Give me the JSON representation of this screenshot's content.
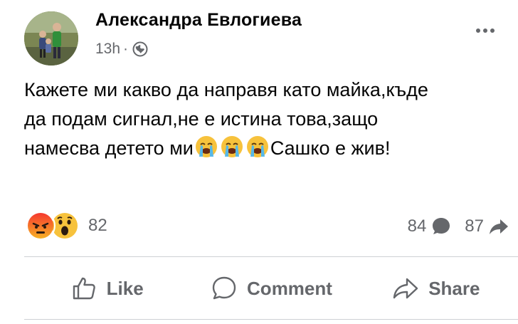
{
  "post": {
    "author": "Александра Евлогиева",
    "time": "13h",
    "separator": "·",
    "audience_icon": "globe-icon",
    "text_line1": "Кажете ми какво да направя като майка,къде",
    "text_line2": "да подам сигнал,не е истина това,защо",
    "text_line3_before": "намесва детето ми",
    "text_line3_after": "Сашко е жив!",
    "inline_emoji": "loudly-crying-face-emoji",
    "inline_emoji_count": 3
  },
  "reactions": {
    "icons": [
      "angry-reaction-icon",
      "wow-reaction-icon"
    ],
    "count": "82",
    "comments_count": "84",
    "shares_count": "87"
  },
  "actions": {
    "like_label": "Like",
    "comment_label": "Comment",
    "share_label": "Share"
  },
  "colors": {
    "secondary_text": "#65676b",
    "divider": "#ced0d4",
    "angry": "#e9710f",
    "wow": "#f7b125"
  }
}
